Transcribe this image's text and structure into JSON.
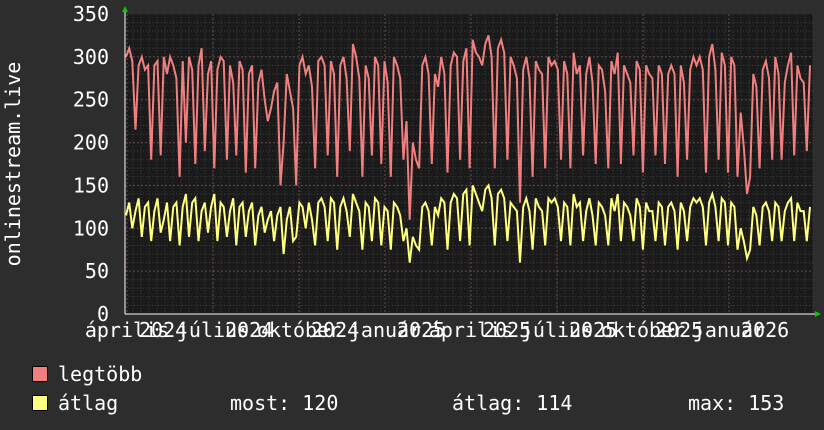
{
  "chart_data": {
    "type": "line",
    "ylabel": "onlinestream.live",
    "ylim": [
      0,
      350
    ],
    "yticks": [
      0,
      50,
      100,
      150,
      200,
      250,
      300,
      350
    ],
    "xticks": [
      "április",
      "július",
      "október",
      "január",
      "április",
      "július",
      "október",
      "január"
    ],
    "xtick_years": [
      "2024",
      "2024",
      "2024",
      "2025",
      "2025",
      "2025",
      "2025",
      "2026"
    ],
    "grid": true,
    "series": [
      {
        "name": "legtöbb",
        "color": "#f08080",
        "values": [
          300,
          310,
          295,
          215,
          290,
          300,
          285,
          290,
          180,
          290,
          295,
          185,
          300,
          280,
          300,
          290,
          275,
          160,
          295,
          200,
          300,
          285,
          175,
          290,
          310,
          190,
          280,
          295,
          170,
          285,
          300,
          295,
          180,
          290,
          270,
          185,
          295,
          285,
          165,
          280,
          290,
          170,
          270,
          285,
          250,
          225,
          240,
          260,
          270,
          150,
          200,
          280,
          260,
          240,
          150,
          290,
          300,
          280,
          290,
          265,
          170,
          295,
          300,
          290,
          185,
          295,
          280,
          160,
          290,
          300,
          275,
          190,
          315,
          300,
          275,
          160,
          290,
          275,
          185,
          300,
          290,
          175,
          295,
          270,
          160,
          300,
          290,
          275,
          180,
          225,
          110,
          200,
          180,
          170,
          290,
          300,
          280,
          175,
          280,
          265,
          300,
          280,
          165,
          290,
          305,
          300,
          180,
          295,
          310,
          170,
          320,
          305,
          300,
          290,
          315,
          325,
          300,
          170,
          310,
          320,
          305,
          180,
          300,
          290,
          275,
          130,
          285,
          300,
          275,
          160,
          295,
          285,
          280,
          170,
          300,
          290,
          295,
          285,
          180,
          295,
          280,
          170,
          305,
          280,
          290,
          185,
          280,
          300,
          270,
          175,
          290,
          285,
          260,
          170,
          295,
          280,
          305,
          175,
          290,
          280,
          270,
          185,
          295,
          285,
          165,
          290,
          280,
          275,
          185,
          290,
          280,
          175,
          280,
          290,
          280,
          160,
          290,
          270,
          180,
          285,
          300,
          290,
          300,
          285,
          165,
          300,
          315,
          285,
          180,
          305,
          290,
          165,
          300,
          290,
          160,
          235,
          195,
          140,
          160,
          280,
          265,
          170,
          285,
          295,
          275,
          180,
          300,
          280,
          180,
          270,
          290,
          305,
          185,
          290,
          275,
          270,
          190,
          290
        ]
      },
      {
        "name": "átlag",
        "color": "#ffff80",
        "values": [
          115,
          130,
          100,
          120,
          135,
          90,
          125,
          130,
          85,
          120,
          135,
          95,
          110,
          130,
          85,
          125,
          130,
          80,
          125,
          140,
          90,
          130,
          135,
          85,
          120,
          130,
          95,
          125,
          140,
          85,
          130,
          125,
          90,
          120,
          135,
          80,
          125,
          130,
          90,
          120,
          130,
          80,
          115,
          125,
          95,
          110,
          120,
          85,
          115,
          125,
          70,
          110,
          125,
          85,
          90,
          130,
          125,
          100,
          130,
          110,
          80,
          130,
          135,
          125,
          85,
          135,
          130,
          75,
          125,
          135,
          120,
          90,
          140,
          130,
          120,
          75,
          130,
          125,
          85,
          135,
          130,
          80,
          125,
          120,
          75,
          130,
          125,
          115,
          85,
          100,
          60,
          90,
          80,
          75,
          125,
          130,
          120,
          80,
          125,
          115,
          135,
          130,
          75,
          130,
          140,
          135,
          85,
          140,
          145,
          80,
          150,
          140,
          130,
          120,
          145,
          150,
          135,
          80,
          140,
          145,
          135,
          85,
          130,
          125,
          120,
          60,
          125,
          135,
          120,
          75,
          135,
          125,
          120,
          80,
          135,
          130,
          135,
          125,
          85,
          130,
          125,
          80,
          140,
          125,
          130,
          85,
          120,
          135,
          115,
          80,
          130,
          125,
          115,
          80,
          135,
          120,
          140,
          85,
          130,
          125,
          115,
          85,
          135,
          125,
          75,
          130,
          120,
          120,
          85,
          130,
          125,
          80,
          125,
          130,
          120,
          75,
          130,
          120,
          85,
          125,
          135,
          130,
          135,
          125,
          80,
          130,
          140,
          125,
          85,
          135,
          130,
          80,
          130,
          125,
          75,
          100,
          85,
          65,
          75,
          125,
          115,
          80,
          125,
          130,
          120,
          85,
          130,
          125,
          85,
          120,
          130,
          135,
          85,
          130,
          120,
          120,
          85,
          125
        ]
      }
    ]
  },
  "legend": {
    "max_label": "legtöbb",
    "avg_label": "átlag",
    "now_text": "most: 120",
    "avg_text": "átlag: 114",
    "max_text": "max: 153"
  }
}
